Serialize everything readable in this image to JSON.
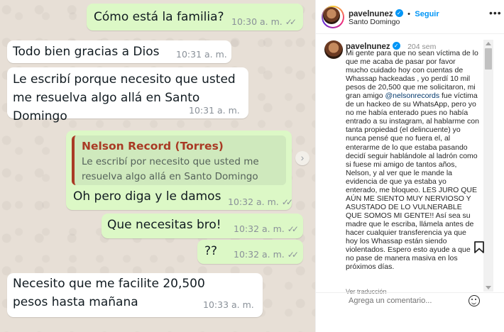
{
  "chat": {
    "messages": [
      {
        "dir": "out",
        "text": "Cómo está la familia?",
        "time": "10:30 a. m.",
        "ticks": "✓✓"
      },
      {
        "dir": "in",
        "text": "Todo bien gracias a Dios",
        "time": "10:31 a. m."
      },
      {
        "dir": "in",
        "text": "Le escribí porque necesito que usted me resuelva algo allá en Santo Domingo",
        "time": "10:31 a. m."
      },
      {
        "dir": "out",
        "quote_name": "Nelson Record (Torres)",
        "quote_text": "Le escribí por necesito que usted me resuelva algo allá en Santo Domingo",
        "text": "Oh pero diga y le damos",
        "time": "10:32 a. m.",
        "ticks": "✓✓"
      },
      {
        "dir": "out",
        "text": "Que necesitas bro!",
        "time": "10:32 a. m.",
        "ticks": "✓✓"
      },
      {
        "dir": "out",
        "text": "??",
        "time": "10:32 a. m.",
        "ticks": "✓✓"
      },
      {
        "dir": "in",
        "text": "Necesito que me facilite 20,500 pesos hasta mañana",
        "time": "10:33 a. m."
      }
    ],
    "forward_icon": "chevron-right-icon"
  },
  "post": {
    "username": "pavelnunez",
    "verified_icon": "verified-badge-icon",
    "follow_label": "Seguir",
    "separator": "•",
    "location": "Santo Domingo",
    "more_icon": "more-horizontal-icon",
    "caption_age": "204 sem",
    "caption_before_mention": "Mi gente para que no sean víctima de lo que me acaba de pasar por favor mucho cuidado hoy con cuentas de Whassap hackeadas , yo perdí 10 mil pesos de 20,500 que me solicitaron, mi gran amigo ",
    "caption_mention": "@nelsonrecords",
    "caption_after_mention": " fue víctima de un hackeo de su WhatsApp, pero yo no me había enterado pues no había entrado a su instagram, al hablarme con tanta propiedad (el delincuente) yo nunca pensé que no fuera el, al enterarme de lo que estaba pasando decidí seguir hablándole al ladrón como si fuese mi amigo de tantos años, Nelson, y al ver que le mande la evidencia de que ya estaba yo enterado, me bloqueo. LES JURO QUE AÚN ME SIENTO MUY NERVIOSO Y ASUSTADO DE LO VULNERABLE QUE SOMOS MI GENTE!! Así sea su madre que le escriba, llámela antes de hacer cualquier transferencia ya que hoy los Whassap están siendo violentados. Espero esto ayude a que no pase de manera masiva en los próximos días.",
    "translate_label": "Ver traducción",
    "comment_placeholder": "Agrega un comentario...",
    "bookmark_icon": "bookmark-icon",
    "emoji_icon": "emoji-icon"
  }
}
